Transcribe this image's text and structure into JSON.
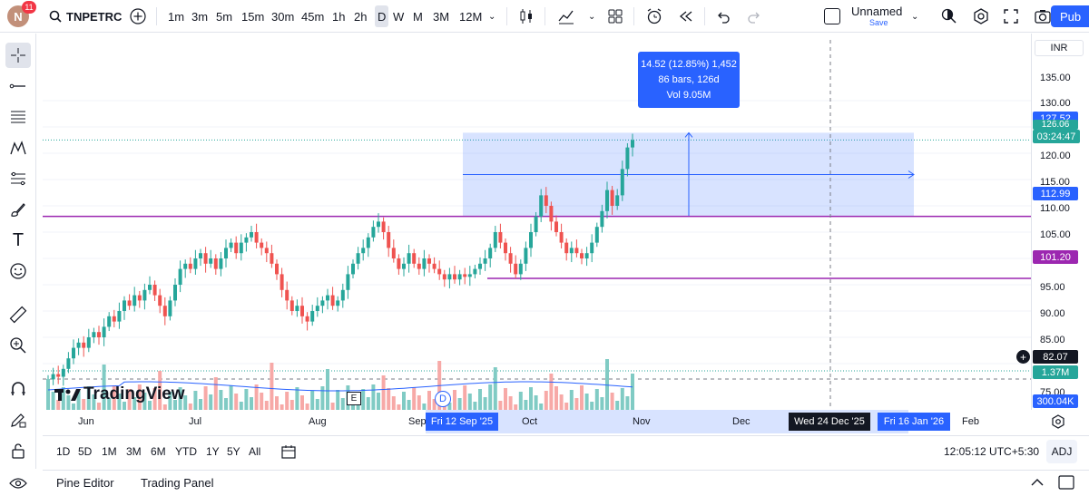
{
  "header": {
    "avatar_letter": "N",
    "notification_count": "11",
    "symbol": "TNPETRC",
    "intervals": [
      "1m",
      "3m",
      "5m",
      "15m",
      "30m",
      "45m",
      "1h",
      "2h",
      "D",
      "W",
      "M",
      "3M",
      "12M"
    ],
    "active_interval": "D",
    "layout_name": "Unnamed",
    "save_label": "Save",
    "publish_label": "Pub"
  },
  "chart": {
    "currency": "INR",
    "price_ticks": [
      "135.00",
      "130.00",
      "125.00",
      "120.00",
      "115.00",
      "110.00",
      "105.00",
      "100.00",
      "95.00",
      "90.00",
      "85.00",
      "75.00"
    ],
    "last_price": "127.52",
    "prev_price": "126.06",
    "countdown": "03:24:47",
    "line1_price": "112.99",
    "line2_price": "101.20",
    "crosshair_price": "82.07",
    "volume_tag": "1.37M",
    "volume_ma_tag": "300.04K",
    "measure": {
      "line1": "14.52 (12.85%) 1,452",
      "line2": "86 bars, 126d",
      "line3": "Vol 9.05M"
    },
    "watermark": "TradingView",
    "event_badge": "D",
    "colors": {
      "up": "#26a69a",
      "down": "#ef5350",
      "up_vol": "#80cbc4",
      "down_vol": "#f7a9a7",
      "hline": "#9c27b0",
      "accent": "#2962ff"
    }
  },
  "time_axis": {
    "labels": [
      "Jun",
      "Jul",
      "Aug",
      "Sep",
      "Oct",
      "Nov",
      "Dec",
      "Feb"
    ],
    "tag_start": "Fri 12 Sep '25",
    "tag_crosshair": "Wed 24 Dec '25",
    "tag_end": "Fri 16 Jan '26"
  },
  "bottom": {
    "ranges": [
      "1D",
      "5D",
      "1M",
      "3M",
      "6M",
      "YTD",
      "1Y",
      "5Y",
      "All"
    ],
    "clock": "12:05:12 UTC+5:30",
    "adj_label": "ADJ"
  },
  "panels": {
    "pine_editor": "Pine Editor",
    "trading_panel": "Trading Panel"
  }
}
